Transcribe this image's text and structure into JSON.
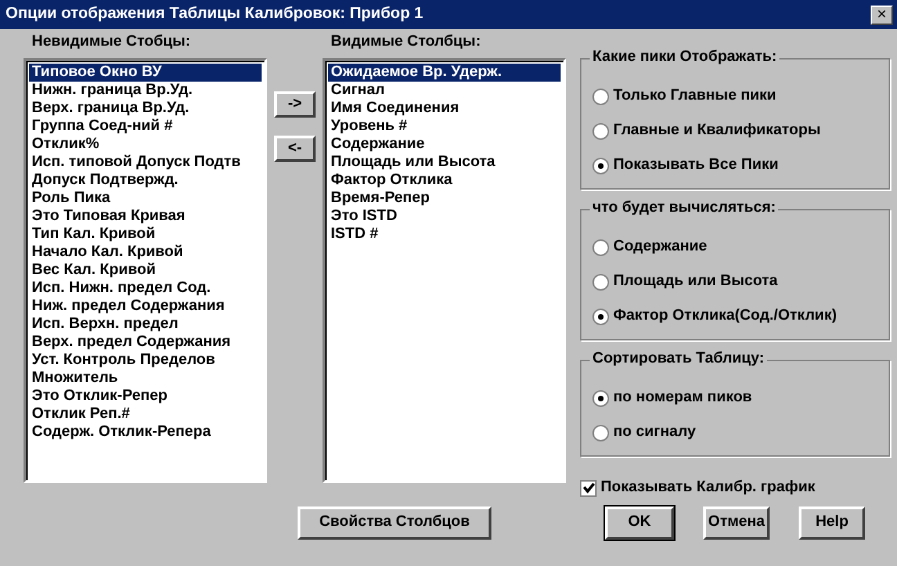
{
  "window": {
    "title": "Опции отображения Таблицы Калибровок: Прибор 1",
    "close": "×"
  },
  "hidden_columns": {
    "label": "Невидимые Стобцы:",
    "items": [
      {
        "text": "Типовое Окно ВУ",
        "selected": true
      },
      {
        "text": "Нижн. граница Вр.Уд.",
        "selected": false
      },
      {
        "text": "Верх. граница Вр.Уд.",
        "selected": false
      },
      {
        "text": "Группа Соед-ний #",
        "selected": false
      },
      {
        "text": "Отклик%",
        "selected": false
      },
      {
        "text": "Исп. типовой Допуск Подтв",
        "selected": false
      },
      {
        "text": "Допуск Подтвержд.",
        "selected": false
      },
      {
        "text": "Роль Пика",
        "selected": false
      },
      {
        "text": "Это Типовая Кривая",
        "selected": false
      },
      {
        "text": "Тип Кал. Кривой",
        "selected": false
      },
      {
        "text": "Начало Кал. Кривой",
        "selected": false
      },
      {
        "text": "Вес Кал. Кривой",
        "selected": false
      },
      {
        "text": "Исп. Нижн. предел Сод.",
        "selected": false
      },
      {
        "text": "Ниж. предел Содержания",
        "selected": false
      },
      {
        "text": "Исп. Верхн. предел",
        "selected": false
      },
      {
        "text": "Верх. предел Содержания",
        "selected": false
      },
      {
        "text": "Уст. Контроль Пределов",
        "selected": false
      },
      {
        "text": "Множитель",
        "selected": false
      },
      {
        "text": "Это Отклик-Репер",
        "selected": false
      },
      {
        "text": "Отклик Реп.#",
        "selected": false
      },
      {
        "text": "Содерж. Отклик-Репера",
        "selected": false
      }
    ]
  },
  "move_buttons": [
    "->",
    "<-"
  ],
  "visible_columns": {
    "label": "Видимые Столбцы:",
    "items": [
      {
        "text": "Ожидаемое Вр. Удерж.",
        "selected": true
      },
      {
        "text": "Сигнал",
        "selected": false
      },
      {
        "text": "Имя Соединения",
        "selected": false
      },
      {
        "text": "Уровень #",
        "selected": false
      },
      {
        "text": "Содержание",
        "selected": false
      },
      {
        "text": "Площадь или Высота",
        "selected": false
      },
      {
        "text": "Фактор Отклика",
        "selected": false
      },
      {
        "text": "Время-Репер",
        "selected": false
      },
      {
        "text": "Это ISTD",
        "selected": false
      },
      {
        "text": "ISTD #",
        "selected": false
      }
    ]
  },
  "option_groups": [
    {
      "title": "Какие пики Отображать:",
      "options": [
        {
          "label": "Только Главные пики",
          "selected": false
        },
        {
          "label": "Главные и Квалификаторы",
          "selected": false
        },
        {
          "label": "Показывать Все Пики",
          "selected": true
        }
      ]
    },
    {
      "title": "что будет вычисляться:",
      "options": [
        {
          "label": "Содержание",
          "selected": false
        },
        {
          "label": "Площадь или Высота",
          "selected": false
        },
        {
          "label": "Фактор Отклика(Сод./Отклик)",
          "selected": true
        }
      ]
    },
    {
      "title": "Сортировать Таблицу:",
      "options": [
        {
          "label": "по номерам пиков",
          "selected": true
        },
        {
          "label": "по сигналу",
          "selected": false
        }
      ]
    }
  ],
  "show_chart": {
    "label": "Показывать Калибр. график",
    "checked": true
  },
  "buttons": [
    {
      "label": "Свойства Столбцов",
      "kind": "wide"
    },
    {
      "label": "OK",
      "kind": "default"
    },
    {
      "label": "Отмена",
      "kind": "normal"
    },
    {
      "label": "Help",
      "kind": "normal"
    }
  ]
}
